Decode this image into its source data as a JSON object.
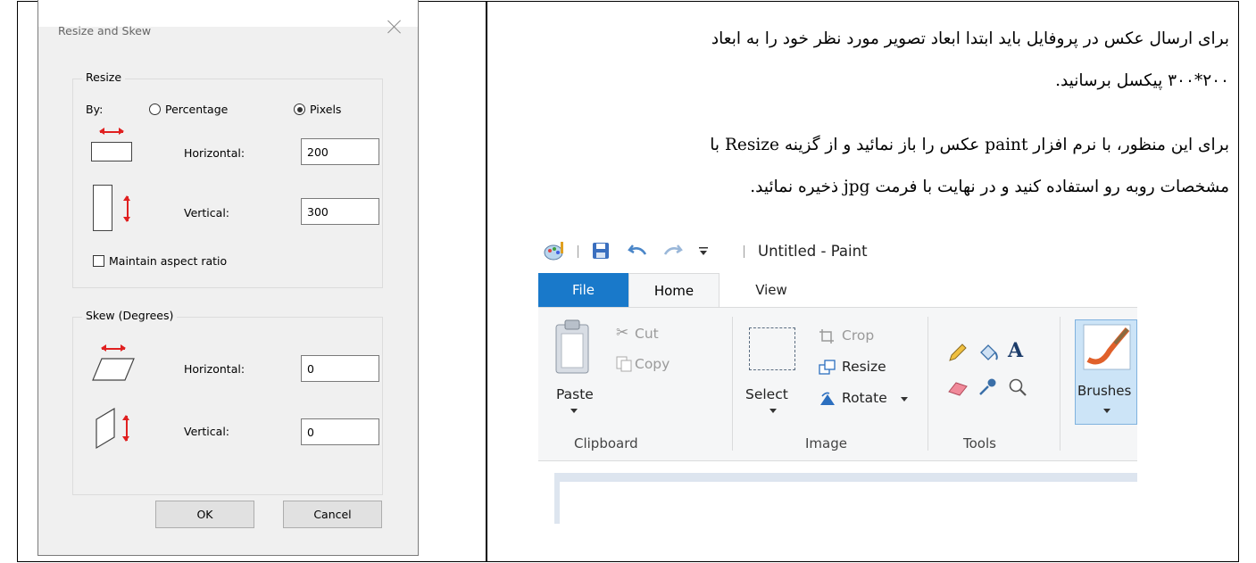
{
  "dialog": {
    "title": "Resize and Skew",
    "resize": {
      "legend": "Resize",
      "by_label": "By:",
      "percentage_label": "Percentage",
      "pixels_label": "Pixels",
      "selected": "Pixels",
      "horizontal_label": "Horizontal:",
      "horizontal_value": "200",
      "vertical_label": "Vertical:",
      "vertical_value": "300",
      "aspect_label": "Maintain aspect ratio",
      "aspect_checked": false
    },
    "skew": {
      "legend": "Skew (Degrees)",
      "horizontal_label": "Horizontal:",
      "horizontal_value": "0",
      "vertical_label": "Vertical:",
      "vertical_value": "0"
    },
    "ok_label": "OK",
    "cancel_label": "Cancel"
  },
  "instructions": {
    "p1_line1": "برای ارسال عکس در پروفایل باید ابتدا ابعاد تصویر مورد نظر خود را به ابعاد",
    "p1_line2": "۲۰۰*۳۰۰ پیکسل برسانید.",
    "p2_line1": "برای این منظور، با نرم افزار paint عکس را باز نمائید و از گزینه Resize با",
    "p2_line2": "مشخصات روبه رو استفاده کنید و در نهایت با فرمت jpg ذخیره نمائید."
  },
  "paint": {
    "window_title": "Untitled - Paint",
    "tabs": [
      "File",
      "Home",
      "View"
    ],
    "active_tab": "Home",
    "clipboard": {
      "paste": "Paste",
      "cut": "Cut",
      "copy": "Copy",
      "group_label": "Clipboard"
    },
    "image": {
      "select": "Select",
      "crop": "Crop",
      "resize": "Resize",
      "rotate": "Rotate",
      "group_label": "Image"
    },
    "tools": {
      "group_label": "Tools"
    },
    "brushes": {
      "label": "Brushes"
    }
  },
  "colors": {
    "file_tab": "#1979ca",
    "ribbon_bg": "#f5f6f7",
    "dialog_bg": "#f0f0f0",
    "arrow_red": "#e02020",
    "brushes_highlight": "#cce4f7"
  }
}
